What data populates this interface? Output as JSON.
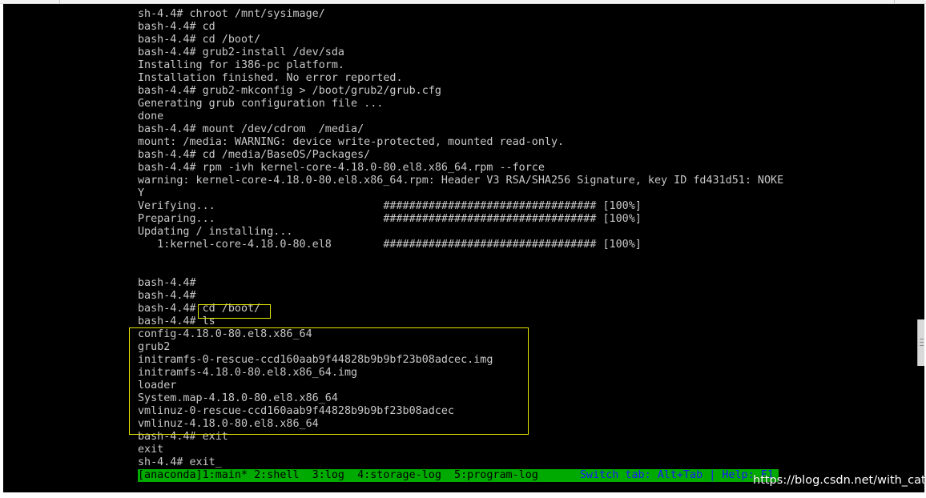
{
  "terminal": {
    "lines": [
      "sh-4.4# chroot /mnt/sysimage/",
      "bash-4.4# cd",
      "bash-4.4# cd /boot/",
      "bash-4.4# grub2-install /dev/sda",
      "Installing for i386-pc platform.",
      "Installation finished. No error reported.",
      "bash-4.4# grub2-mkconfig > /boot/grub2/grub.cfg",
      "Generating grub configuration file ...",
      "done",
      "bash-4.4# mount /dev/cdrom  /media/",
      "mount: /media: WARNING: device write-protected, mounted read-only.",
      "bash-4.4# cd /media/BaseOS/Packages/",
      "bash-4.4# rpm -ivh kernel-core-4.18.0-80.el8.x86_64.rpm --force",
      "warning: kernel-core-4.18.0-80.el8.x86_64.rpm: Header V3 RSA/SHA256 Signature, key ID fd431d51: NOKE",
      "Y",
      "Verifying...                          ################################# [100%]",
      "Preparing...                          ################################# [100%]",
      "Updating / installing...",
      "   1:kernel-core-4.18.0-80.el8        ################################# [100%]",
      "",
      "",
      "bash-4.4#",
      "bash-4.4#",
      "bash-4.4# cd /boot/",
      "bash-4.4# ls",
      "config-4.18.0-80.el8.x86_64",
      "grub2",
      "initramfs-0-rescue-ccd160aab9f44828b9b9bf23b08adcec.img",
      "initramfs-4.18.0-80.el8.x86_64.img",
      "loader",
      "System.map-4.18.0-80.el8.x86_64",
      "vmlinuz-0-rescue-ccd160aab9f44828b9b9bf23b08adcec",
      "vmlinuz-4.18.0-80.el8.x86_64",
      "bash-4.4# exit",
      "exit",
      "sh-4.4# exit_"
    ]
  },
  "statusbar": {
    "tabs_text": "[anaconda]1:main* 2:shell  3:log  4:storage-log  5:program-log",
    "help_text": "Switch tab: Alt+Tab | Help: F1"
  },
  "watermark": {
    "text": "https://blog.csdn.net/with_cat"
  },
  "colors": {
    "console_bg": "#000000",
    "console_text": "#c8c8c8",
    "statusbar_bg": "#00aa00",
    "statusbar_text": "#000000",
    "help_text": "#1a1aff",
    "highlight": "#e6e600"
  }
}
